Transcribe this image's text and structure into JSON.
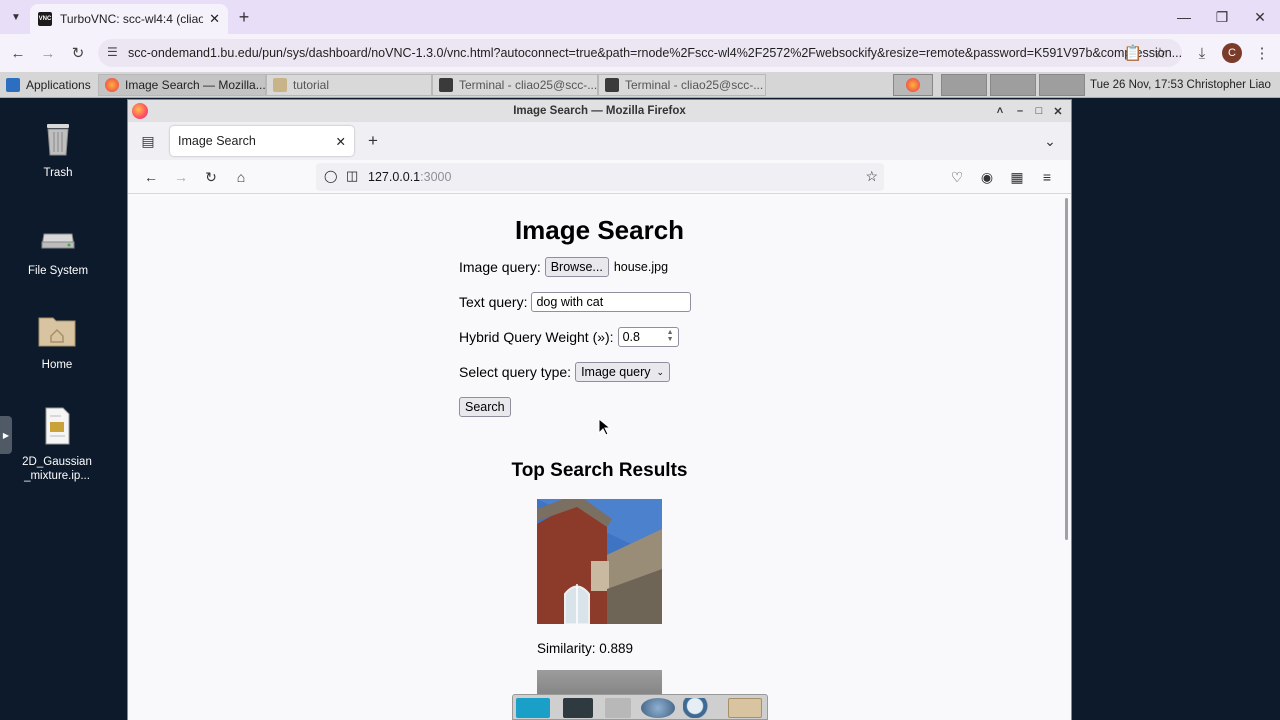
{
  "chrome": {
    "tab_title": "TurboVNC: scc-wl4:4 (cliao25)",
    "tab_icon_label": "VNC",
    "url": "scc-ondemand1.bu.edu/pun/sys/dashboard/noVNC-1.3.0/vnc.html?autoconnect=true&path=rnode%2Fscc-wl4%2F2572%2Fwebsockify&resize=remote&password=K591V97b&compression...",
    "profile_initial": "C"
  },
  "panel": {
    "applications_label": "Applications",
    "tasks": [
      {
        "label": "Image Search — Mozilla..."
      },
      {
        "label": "tutorial"
      },
      {
        "label": "Terminal - cliao25@scc-..."
      },
      {
        "label": "Terminal - cliao25@scc-..."
      }
    ],
    "clock": "Tue 26 Nov, 17:53",
    "user": "Christopher Liao"
  },
  "desktop": {
    "icons": [
      {
        "label": "Trash"
      },
      {
        "label": "File System"
      },
      {
        "label": "Home"
      },
      {
        "label": "2D_Gaussian _mixture.ip..."
      }
    ]
  },
  "firefox": {
    "window_title": "Image Search — Mozilla Firefox",
    "tab_title": "Image Search",
    "url_host": "127.0.0.1",
    "url_port": ":3000"
  },
  "page": {
    "title": "Image Search",
    "image_query_label": "Image query:",
    "browse_label": "Browse...",
    "file_name": "house.jpg",
    "text_query_label": "Text query:",
    "text_query_value": "dog with cat",
    "weight_label": "Hybrid Query Weight (»):",
    "weight_value": "0.8",
    "query_type_label": "Select query type:",
    "query_type_value": "Image query",
    "search_button": "Search",
    "results_title": "Top Search Results",
    "similarity": "Similarity: 0.889"
  }
}
